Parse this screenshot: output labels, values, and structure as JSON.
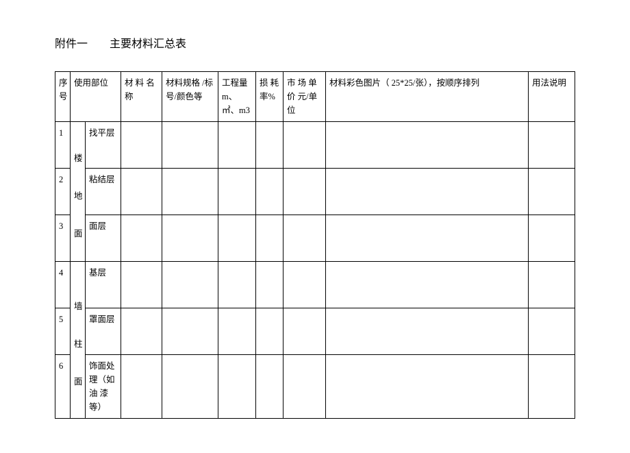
{
  "heading": {
    "prefix": "附件一",
    "title": "主要材料汇总表"
  },
  "headers": {
    "seq": "序号",
    "part": "使用部位",
    "name": "材 料 名称",
    "spec": "材料规格 /标号/颜色等",
    "qty": "工程量m、㎡、m3",
    "loss": "损 耗率%",
    "price": "市 场 单价  元/单位",
    "img": "材料彩色图片（  25*25/张），按顺序排列",
    "usage": "用法说明"
  },
  "groups": {
    "g1": "楼地面",
    "g2": "墙柱面"
  },
  "rows": {
    "r1": {
      "seq": "1",
      "layer": "找平层"
    },
    "r2": {
      "seq": "2",
      "layer": "粘结层"
    },
    "r3": {
      "seq": "3",
      "layer": "面层"
    },
    "r4": {
      "seq": "4",
      "layer": "基层"
    },
    "r5": {
      "seq": "5",
      "layer": "罩面层"
    },
    "r6": {
      "seq": "6",
      "layer": "饰面处理（如油 漆等）"
    }
  }
}
